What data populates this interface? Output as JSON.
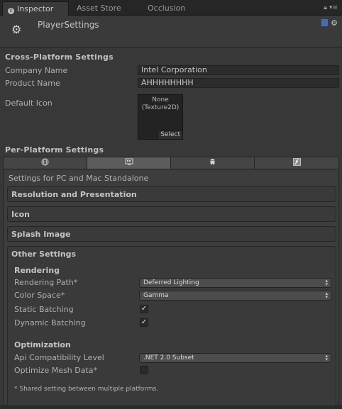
{
  "tabs": [
    "Inspector",
    "Asset Store",
    "Occlusion"
  ],
  "header": {
    "title": "PlayerSettings"
  },
  "cross_platform": {
    "title": "Cross-Platform Settings",
    "company_label": "Company Name",
    "company_value": "Intel Corporation",
    "product_label": "Product Name",
    "product_value": "AHHHHHHHH",
    "icon_label": "Default Icon",
    "icon_none": "None",
    "icon_type": "(Texture2D)",
    "icon_select": "Select"
  },
  "per_platform": {
    "title": "Per-Platform Settings",
    "platform_tabs": [
      "web-icon",
      "windows-icon",
      "android-icon",
      "flash-icon"
    ],
    "subtitle": "Settings for PC and Mac Standalone"
  },
  "sections": {
    "resolution": "Resolution and Presentation",
    "icon": "Icon",
    "splash": "Splash Image",
    "other": "Other Settings"
  },
  "rendering": {
    "title": "Rendering",
    "path_label": "Rendering Path*",
    "path_value": "Deferred Lighting",
    "color_label": "Color Space*",
    "color_value": "Gamma",
    "static_label": "Static Batching",
    "static_checked": "✓",
    "dynamic_label": "Dynamic Batching",
    "dynamic_checked": "✓"
  },
  "optimization": {
    "title": "Optimization",
    "api_label": "Api Compatibility Level",
    "api_value": ".NET 2.0 Subset",
    "mesh_label": "Optimize Mesh Data*"
  },
  "footnote": "* Shared setting between multiple platforms."
}
